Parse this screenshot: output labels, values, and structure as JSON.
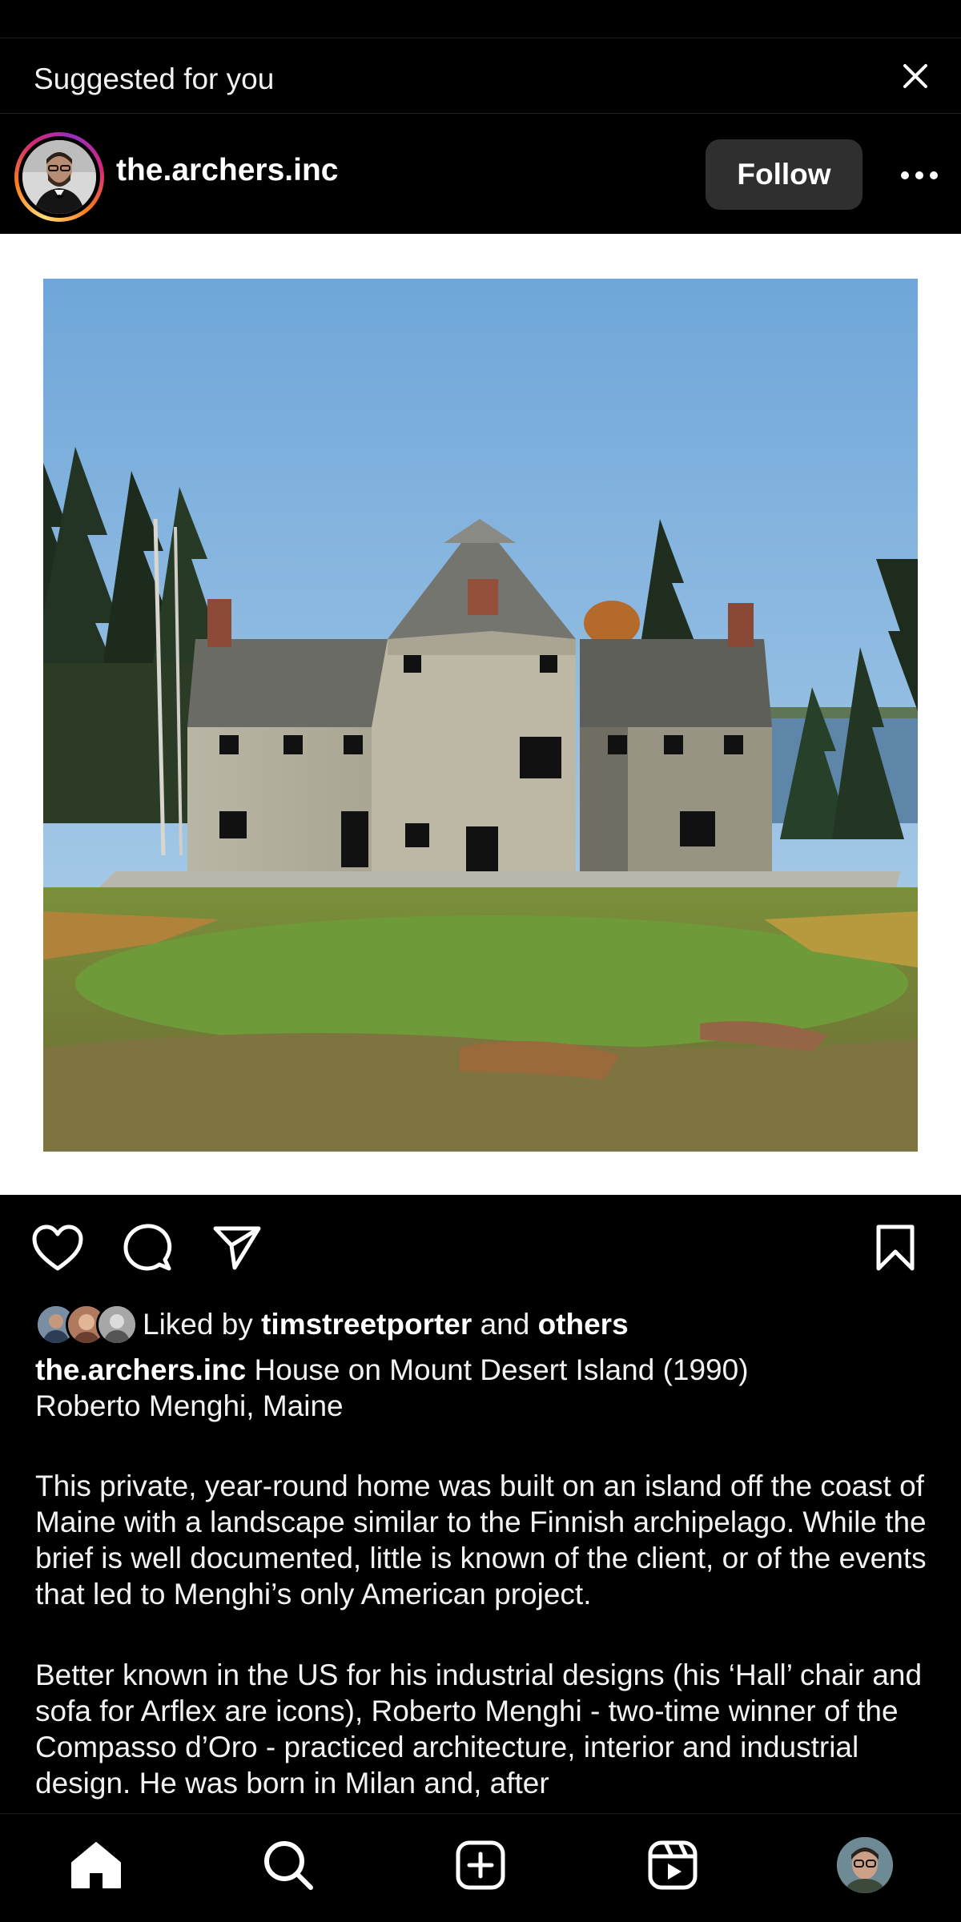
{
  "suggested": {
    "label": "Suggested for you",
    "close_icon": "close-icon"
  },
  "post": {
    "username": "the.archers.inc",
    "follow_label": "Follow",
    "more_icon": "more-horizontal-icon",
    "image_alt": "Shingled house with steep roofs on a grassy island site surrounded by pine trees"
  },
  "actions": {
    "like_icon": "heart-icon",
    "comment_icon": "comment-icon",
    "share_icon": "send-icon",
    "save_icon": "bookmark-icon"
  },
  "likes": {
    "prefix": "Liked by",
    "user": "timstreetporter",
    "middle": "and",
    "others": "others"
  },
  "caption": {
    "username": "the.archers.inc",
    "title_line1": "House on Mount Desert Island (1990)",
    "title_line2": "Roberto Menghi, Maine",
    "paragraph1": "This private, year-round home was built on an island off the coast of Maine with a landscape similar to the Finnish archipelago.  While the brief is well documented, little is known of the client, or of the events that led to Menghi’s only American project.",
    "paragraph2": "Better known in the US for his industrial designs (his ‘Hall’ chair and sofa for Arflex are icons), Roberto Menghi - two-time winner of the Compasso d’Oro - practiced architecture, interior and industrial design.  He was born in Milan and, after"
  },
  "nav": {
    "home_icon": "home-icon",
    "search_icon": "search-icon",
    "create_icon": "add-post-icon",
    "reels_icon": "reels-icon",
    "profile_icon": "profile-avatar"
  }
}
